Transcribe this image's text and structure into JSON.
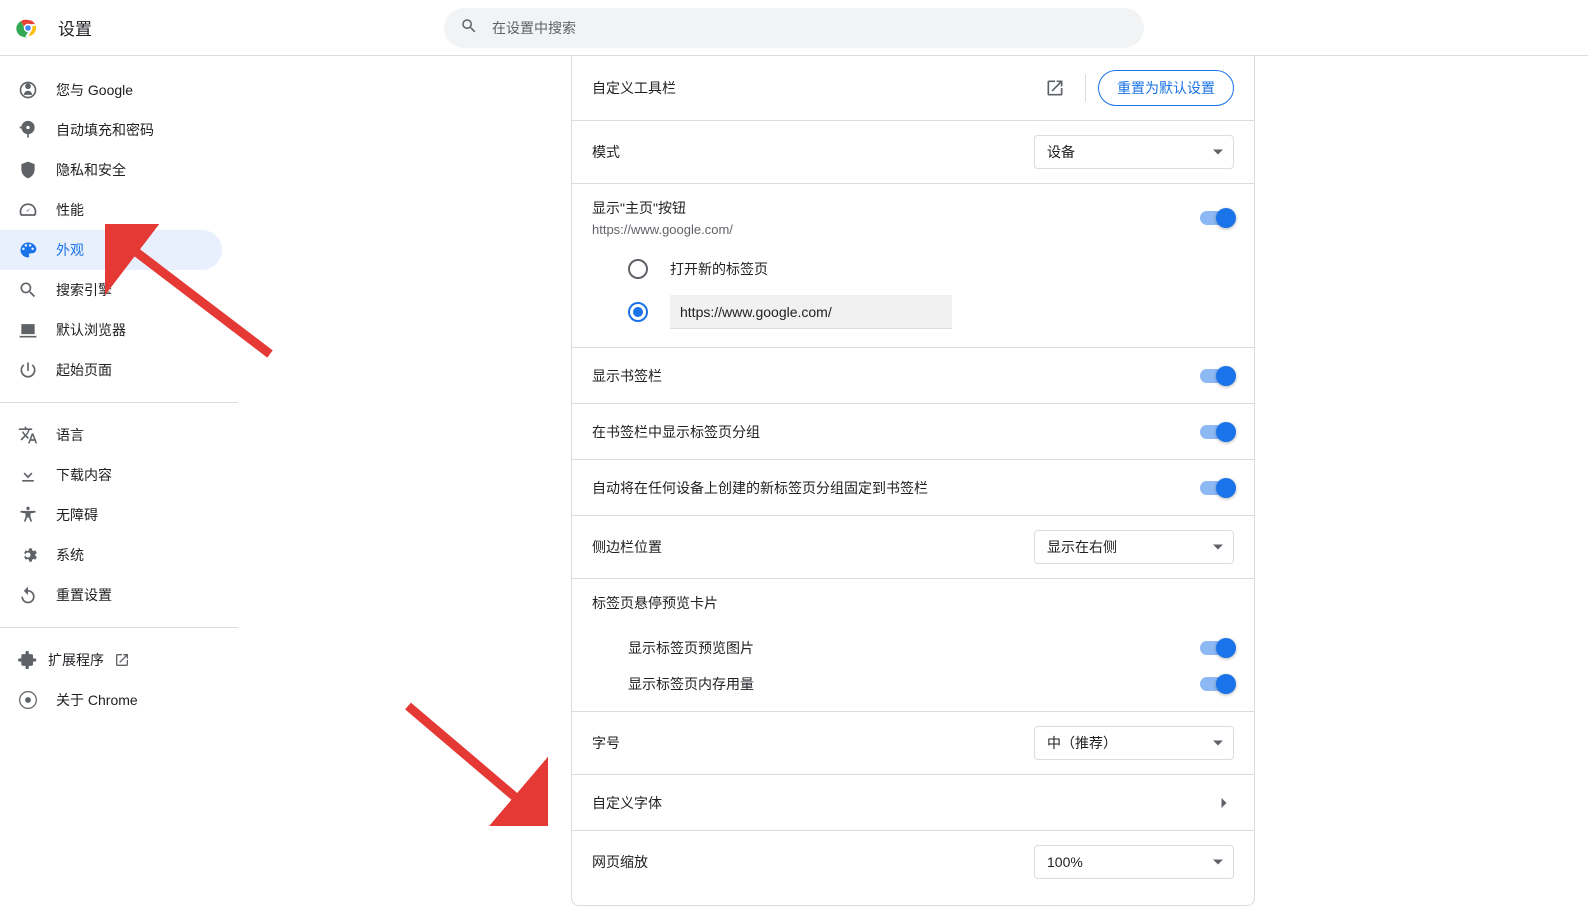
{
  "header": {
    "title": "设置",
    "search_placeholder": "在设置中搜索"
  },
  "sidebar": {
    "items": [
      {
        "label": "您与 Google"
      },
      {
        "label": "自动填充和密码"
      },
      {
        "label": "隐私和安全"
      },
      {
        "label": "性能"
      },
      {
        "label": "外观"
      },
      {
        "label": "搜索引擎"
      },
      {
        "label": "默认浏览器"
      },
      {
        "label": "起始页面"
      }
    ],
    "items2": [
      {
        "label": "语言"
      },
      {
        "label": "下载内容"
      },
      {
        "label": "无障碍"
      },
      {
        "label": "系统"
      },
      {
        "label": "重置设置"
      }
    ],
    "extensions": "扩展程序",
    "about": "关于 Chrome"
  },
  "main": {
    "toolbar": {
      "title": "自定义工具栏",
      "reset": "重置为默认设置"
    },
    "mode": {
      "label": "模式",
      "value": "设备"
    },
    "home": {
      "label": "显示\"主页\"按钮",
      "sub": "https://www.google.com/",
      "opt_newtab": "打开新的标签页",
      "url_value": "https://www.google.com/"
    },
    "show_bookmarks": "显示书签栏",
    "show_tabgroups_in_bar": "在书签栏中显示标签页分组",
    "pin_new_groups": "自动将在任何设备上创建的新标签页分组固定到书签栏",
    "sidepanel": {
      "label": "侧边栏位置",
      "value": "显示在右侧"
    },
    "hover_section": "标签页悬停预览卡片",
    "hover_img": "显示标签页预览图片",
    "hover_mem": "显示标签页内存用量",
    "fontsize": {
      "label": "字号",
      "value": "中（推荐）"
    },
    "custom_font": "自定义字体",
    "zoom": {
      "label": "网页缩放",
      "value": "100%"
    }
  }
}
